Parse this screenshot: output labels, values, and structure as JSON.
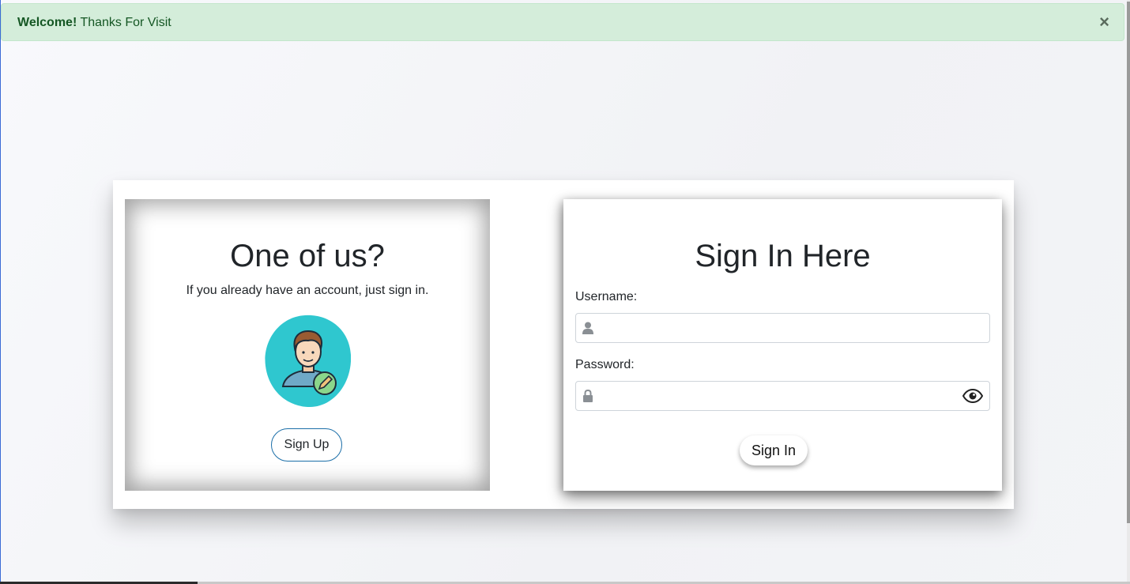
{
  "alert": {
    "strong": "Welcome!",
    "text": " Thanks For Visit",
    "close": "×"
  },
  "signup_panel": {
    "title": "One of us?",
    "subtitle": "If you already have an account, just sign in.",
    "button": "Sign Up"
  },
  "signin_panel": {
    "title": "Sign In Here",
    "username_label": "Username:",
    "username_value": "",
    "password_label": "Password:",
    "password_value": "",
    "button": "Sign In"
  },
  "icons": {
    "username": "user-icon",
    "password": "lock-icon",
    "toggle": "eye-icon",
    "avatar": "user-edit-avatar"
  },
  "colors": {
    "alert_bg": "#d4edda",
    "alert_text": "#155724",
    "avatar_blob": "#2fc7cf",
    "signup_border": "#1b6ea8"
  }
}
